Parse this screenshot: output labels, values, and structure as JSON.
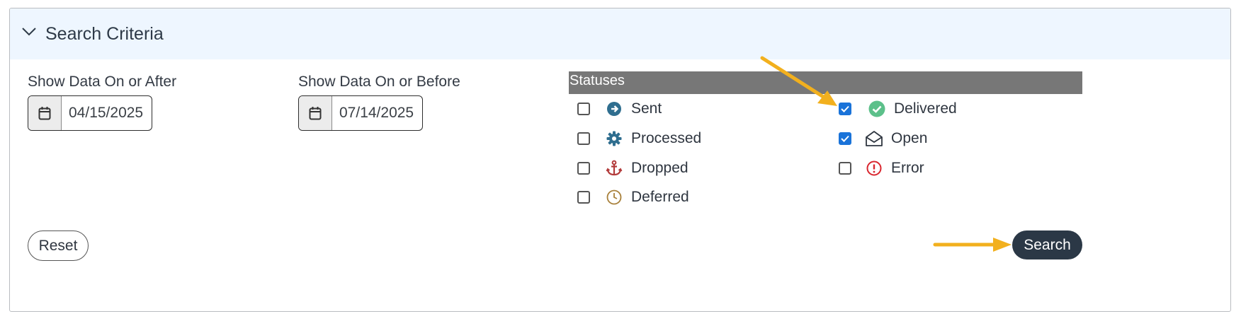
{
  "panel": {
    "title": "Search Criteria"
  },
  "filters": {
    "after_label": "Show Data On or After",
    "after_value": "04/15/2025",
    "before_label": "Show Data On or Before",
    "before_value": "07/14/2025"
  },
  "statuses": {
    "header": "Statuses",
    "items": [
      {
        "label": "Sent",
        "checked": false,
        "icon": "arrow-circle-right-icon",
        "color": "#2f6e8f"
      },
      {
        "label": "Processed",
        "checked": false,
        "icon": "gear-icon",
        "color": "#2f6e8f"
      },
      {
        "label": "Dropped",
        "checked": false,
        "icon": "anchor-icon",
        "color": "#b23a3a"
      },
      {
        "label": "Deferred",
        "checked": false,
        "icon": "clock-icon",
        "color": "#a8803a"
      },
      {
        "label": "Delivered",
        "checked": true,
        "icon": "check-circle-icon",
        "color": "#5cc08a"
      },
      {
        "label": "Open",
        "checked": true,
        "icon": "envelope-open-icon",
        "color": "#2f3640"
      },
      {
        "label": "Error",
        "checked": false,
        "icon": "exclamation-circle-icon",
        "color": "#d9262e"
      }
    ]
  },
  "actions": {
    "reset_label": "Reset",
    "search_label": "Search"
  },
  "colors": {
    "accent": "#1a73d9",
    "annotation_arrow": "#f2b01e",
    "search_button": "#2b3846",
    "header_bg": "#eef6ff"
  }
}
